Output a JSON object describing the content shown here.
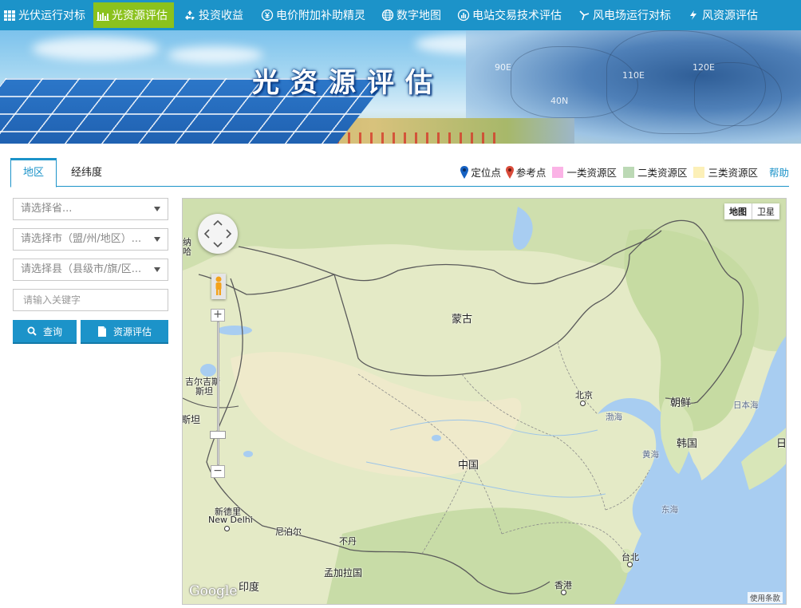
{
  "nav": {
    "items": [
      {
        "label": "光伏运行对标",
        "icon": "grid-icon"
      },
      {
        "label": "光资源评估",
        "icon": "bar-chart-icon",
        "active": true
      },
      {
        "label": "投资收益",
        "icon": "recycle-icon"
      },
      {
        "label": "电价附加补助精灵",
        "icon": "yuan-circle-icon"
      },
      {
        "label": "数字地图",
        "icon": "globe-icon"
      },
      {
        "label": "电站交易技术评估",
        "icon": "chart-circle-icon"
      },
      {
        "label": "风电场运行对标",
        "icon": "wind-icon"
      },
      {
        "label": "风资源评估",
        "icon": "wind-icon"
      }
    ],
    "active_color": "#8bc21d",
    "bar_color": "#1c93c9"
  },
  "banner": {
    "title": "光资源评估",
    "grid_labels": [
      "90E",
      "110E",
      "120E",
      "40N"
    ]
  },
  "tabs": {
    "region": "地区",
    "latlng": "经纬度"
  },
  "legend": {
    "locate": "定位点",
    "reference": "参考点",
    "class1": "一类资源区",
    "class2": "二类资源区",
    "class3": "三类资源区",
    "help": "帮助",
    "colors": {
      "class1": "#fbb3e6",
      "class2": "#bcd9b5",
      "class3": "#fcf0b8",
      "locate_pin": "#1561c2",
      "reference_pin": "#d94b3a"
    }
  },
  "filters": {
    "province": "请选择省...",
    "city": "请选择市（盟/州/地区）...",
    "county": "请选择县（县级市/旗/区...",
    "keyword_placeholder": "请输入关键字",
    "search_button": "查询",
    "assess_button": "资源评估"
  },
  "map": {
    "type_map": "地图",
    "type_satellite": "卫星",
    "labels": {
      "mongolia": "蒙古",
      "china": "中国",
      "korea_north": "朝鲜",
      "korea_south": "韩国",
      "japan_sea": "日本海",
      "japan": "日",
      "beijing": "北京",
      "bohai": "渤海",
      "yellow_sea": "黄海",
      "east_sea": "东海",
      "taipei": "台北",
      "hongkong": "香港",
      "india": "印度",
      "bangladesh": "孟加拉国",
      "bhutan": "不丹",
      "nepal": "尼泊尔",
      "newdelhi_cn": "新德里",
      "newdelhi_en": "New Delhi",
      "kyrgyz": "吉尔吉斯",
      "kyrgyz2": "斯坦",
      "xinjiang_edge": "斯坦",
      "kaz_edge": "纳",
      "ha": "哈"
    },
    "google": "Google",
    "terms": "使用条款"
  }
}
